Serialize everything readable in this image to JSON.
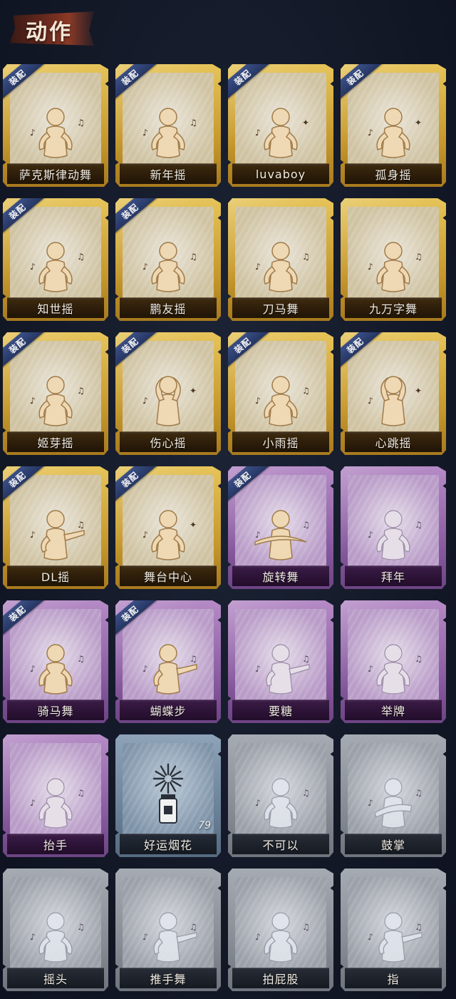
{
  "header": {
    "title": "动作"
  },
  "equip_label": "装配",
  "cards": [
    {
      "label": "萨克斯律动舞",
      "style": "gold",
      "equipped": true,
      "icon": "saxophone-dancer-icon"
    },
    {
      "label": "新年摇",
      "style": "gold",
      "equipped": true,
      "icon": "new-year-dancer-icon"
    },
    {
      "label": "luvaboy",
      "style": "gold",
      "equipped": true,
      "icon": "luvaboy-dancer-icon"
    },
    {
      "label": "孤身摇",
      "style": "gold",
      "equipped": true,
      "icon": "solo-dancer-icon"
    },
    {
      "label": "知世摇",
      "style": "gold",
      "equipped": true,
      "icon": "music-dancer-icon"
    },
    {
      "label": "鹏友摇",
      "style": "gold",
      "equipped": true,
      "icon": "friend-dancer-icon"
    },
    {
      "label": "刀马舞",
      "style": "gold",
      "equipped": false,
      "icon": "blade-dancer-icon"
    },
    {
      "label": "九万字舞",
      "style": "gold",
      "equipped": false,
      "icon": "swirl-dancer-icon"
    },
    {
      "label": "姬芽摇",
      "style": "gold",
      "equipped": true,
      "icon": "note-dancer-icon"
    },
    {
      "label": "伤心摇",
      "style": "gold",
      "equipped": true,
      "icon": "heart-dancer-icon"
    },
    {
      "label": "小雨摇",
      "style": "gold",
      "equipped": true,
      "icon": "rain-dancer-icon"
    },
    {
      "label": "心跳摇",
      "style": "gold",
      "equipped": true,
      "icon": "heartbeat-dancer-icon"
    },
    {
      "label": "DL摇",
      "style": "gold",
      "equipped": true,
      "icon": "pointing-dancer-icon"
    },
    {
      "label": "舞台中心",
      "style": "gold",
      "equipped": true,
      "icon": "stage-dancer-icon"
    },
    {
      "label": "旋转舞",
      "style": "purple",
      "equipped": true,
      "icon": "spin-dancer-icon"
    },
    {
      "label": "拜年",
      "style": "purple",
      "equipped": false,
      "icon": "bow-figure-icon"
    },
    {
      "label": "骑马舞",
      "style": "purple",
      "equipped": true,
      "icon": "horse-dancer-icon"
    },
    {
      "label": "蝴蝶步",
      "style": "purple",
      "equipped": true,
      "icon": "butterfly-step-icon"
    },
    {
      "label": "要糖",
      "style": "purple",
      "equipped": false,
      "icon": "reach-figure-icon"
    },
    {
      "label": "举牌",
      "style": "purple",
      "equipped": false,
      "icon": "sign-holder-icon"
    },
    {
      "label": "抬手",
      "style": "purple",
      "equipped": false,
      "icon": "raise-hand-icon"
    },
    {
      "label": "好运烟花",
      "style": "blue",
      "equipped": false,
      "icon": "firework-icon",
      "count": "79"
    },
    {
      "label": "不可以",
      "style": "gray",
      "equipped": false,
      "icon": "finger-wag-icon"
    },
    {
      "label": "鼓掌",
      "style": "gray",
      "equipped": false,
      "icon": "clap-icon"
    },
    {
      "label": "摇头",
      "style": "gray",
      "equipped": false,
      "icon": "head-shake-icon"
    },
    {
      "label": "推手舞",
      "style": "gray",
      "equipped": false,
      "icon": "push-hand-icon"
    },
    {
      "label": "拍屁股",
      "style": "gray",
      "equipped": false,
      "icon": "butt-slap-icon"
    },
    {
      "label": "指",
      "style": "gray",
      "equipped": false,
      "icon": "point-hand-icon"
    }
  ]
}
